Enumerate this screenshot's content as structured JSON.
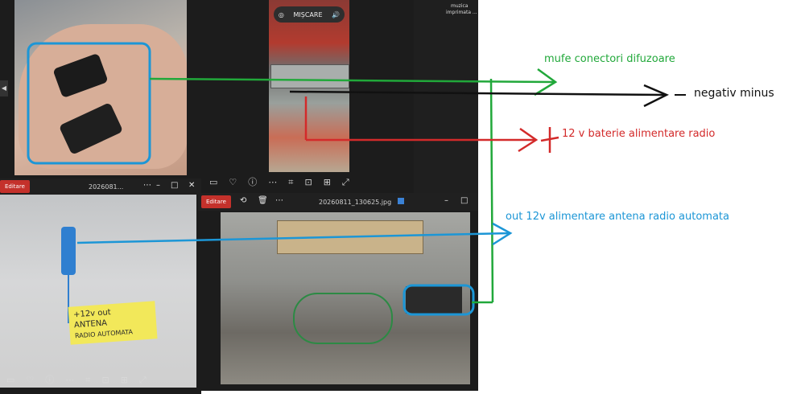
{
  "windows": {
    "top_middle": {
      "motion_label": "MIȘCARE"
    },
    "top_right_label": {
      "line1": "muzica",
      "line2": "imprimata ..."
    },
    "bottom_left": {
      "edit_label": "Editare",
      "filename": "2026081..."
    },
    "bottom_right": {
      "edit_label": "Editare",
      "filename": "20260811_130625.jpg"
    }
  },
  "sticky_note": {
    "line1": "+12v out",
    "line2": "ANTENA",
    "line3": "RADIO AUTOMATA"
  },
  "annotations": {
    "green_label": "mufe conectori difuzoare",
    "black_label": "negativ minus",
    "red_label": "12 v baterie alimentare radio",
    "blue_label": "out 12v alimentare antena radio automata"
  },
  "colors": {
    "green": "#21a83a",
    "black": "#111111",
    "red": "#d32a2a",
    "blue": "#1c96d6",
    "app_bg": "#1c1c1c",
    "edit_red": "#c4312b"
  },
  "icons": {
    "toolbar": [
      "monitor-icon",
      "heart-icon",
      "info-icon",
      "more-icon",
      "crop-icon",
      "scan-icon",
      "fit-icon",
      "expand-icon"
    ],
    "titlebar": [
      "minimize-icon",
      "maximize-icon",
      "close-icon"
    ],
    "motion": [
      "motion-icon",
      "volume-icon"
    ]
  }
}
